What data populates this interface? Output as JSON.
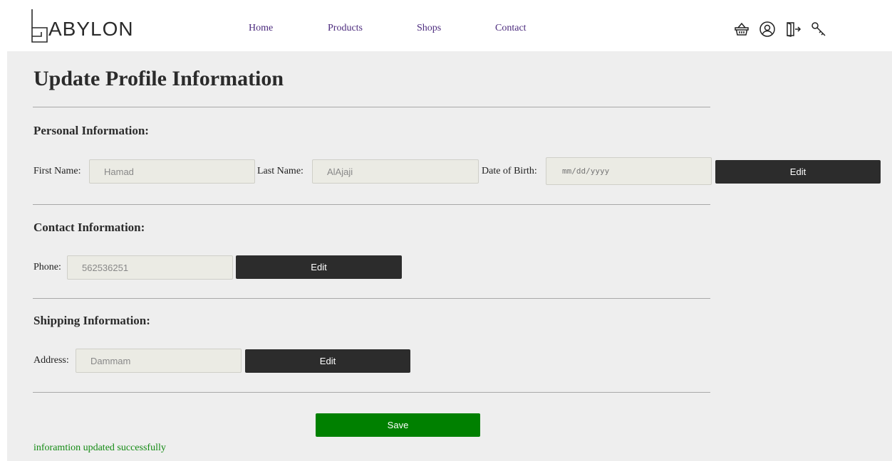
{
  "header": {
    "logo_text": "ABYLON",
    "nav": [
      {
        "label": "Home"
      },
      {
        "label": "Products"
      },
      {
        "label": "Shops"
      },
      {
        "label": "Contact"
      }
    ],
    "icons": [
      "basket-icon",
      "user-icon",
      "logout-icon",
      "key-icon"
    ]
  },
  "page": {
    "title": "Update Profile Information"
  },
  "personal": {
    "title": "Personal Information:",
    "first_name_label": "First Name:",
    "first_name_value": "Hamad",
    "last_name_label": "Last Name:",
    "last_name_value": "AlAjaji",
    "dob_label": "Date of Birth:",
    "dob_placeholder": "mm/dd/yyyy",
    "edit_label": "Edit"
  },
  "contact": {
    "title": "Contact Information:",
    "phone_label": "Phone:",
    "phone_value": "562536251",
    "edit_label": "Edit"
  },
  "shipping": {
    "title": "Shipping Information:",
    "address_label": "Address:",
    "address_value": "Dammam",
    "edit_label": "Edit"
  },
  "actions": {
    "save_label": "Save"
  },
  "status": {
    "message": "inforamtion updated successfully"
  },
  "colors": {
    "nav_link": "#4b2a7d",
    "panel_bg": "#eeeeee",
    "edit_button": "#2c2c2c",
    "save_button": "#008000",
    "success_text": "#138a13"
  }
}
